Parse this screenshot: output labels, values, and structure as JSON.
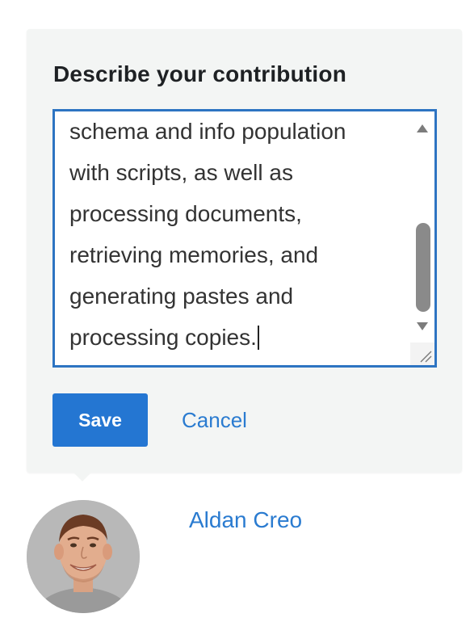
{
  "form": {
    "heading": "Describe your contribution",
    "contribution_text": "schema and info population\nwith scripts, as well as\nprocessing documents,\nretrieving memories, and\ngenerating pastes and\nprocessing copies.",
    "save_label": "Save",
    "cancel_label": "Cancel"
  },
  "author": {
    "name": "Aldan Creo",
    "avatar_icon": "user-avatar-photo"
  },
  "colors": {
    "accent": "#2476d2",
    "link": "#2a7bd0",
    "focus_border": "#2d74c2",
    "card_background": "#f3f5f4",
    "heading_text": "#1e2124"
  },
  "icons": {
    "scroll_up": "scroll-up-arrow-icon",
    "scroll_down": "scroll-down-arrow-icon",
    "resize": "resize-grip-icon"
  }
}
